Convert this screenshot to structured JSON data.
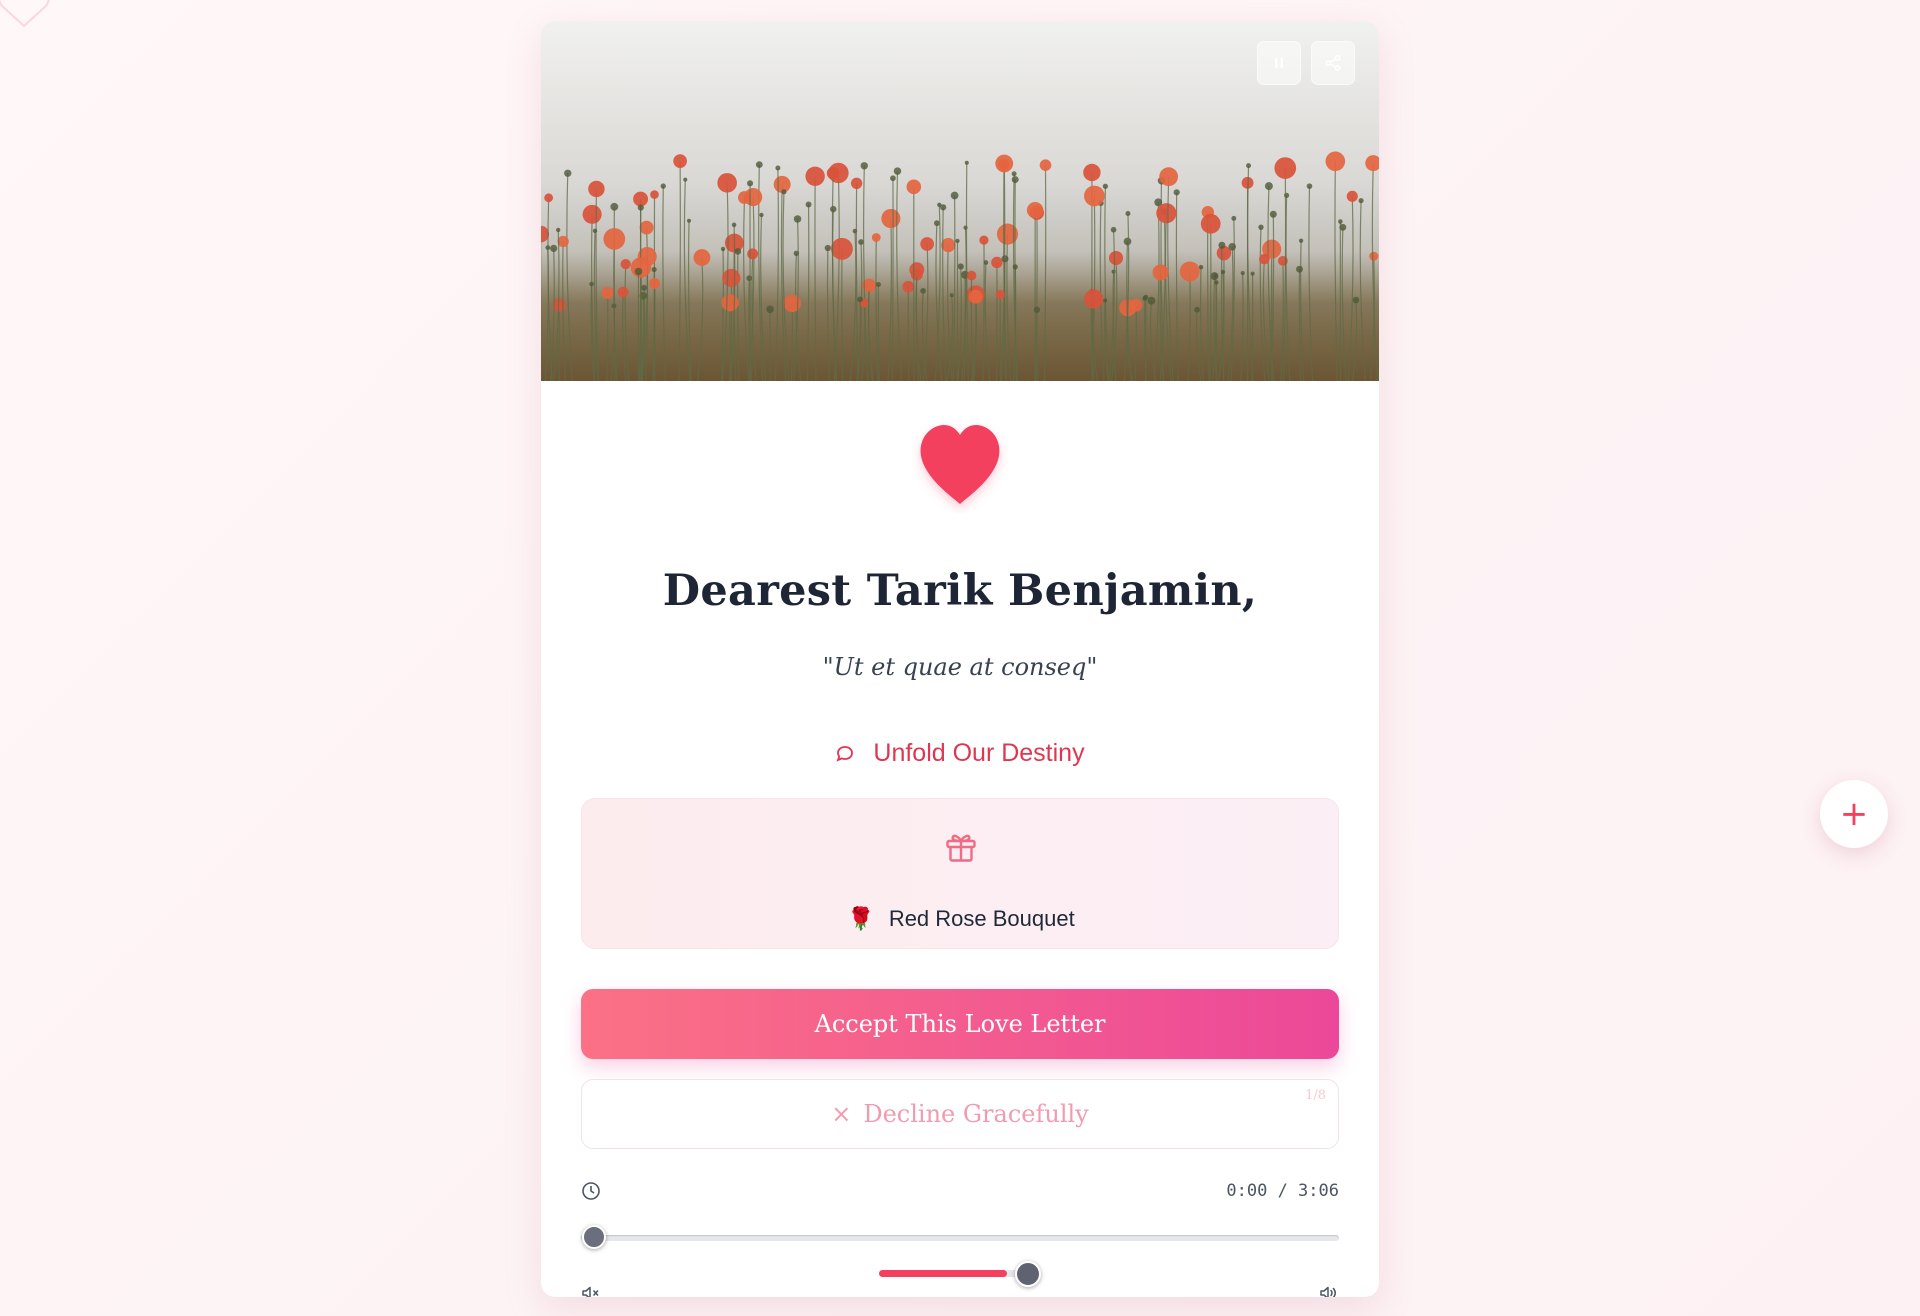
{
  "letter": {
    "greeting": "Dearest Tarik Benjamin,",
    "quote": "\"Ut et quae at conseq\"",
    "unfold_label": "Unfold Our Destiny"
  },
  "hero": {
    "image": "poppy-field-photo",
    "pause_icon": "pause-icon",
    "share_icon": "share-icon"
  },
  "gift": {
    "icon": "gift-icon",
    "emoji": "🌹",
    "label": "Red Rose Bouquet"
  },
  "actions": {
    "accept_label": "Accept This Love Letter",
    "decline_symbol": "×",
    "decline_label": "Decline Gracefully",
    "decline_counter": "1/8"
  },
  "player": {
    "time": "0:00 / 3:06",
    "progress": 0.0,
    "volume": 0.8
  },
  "fab": {
    "symbol": "+"
  },
  "colors": {
    "accent": "#f43f5e",
    "accept_gradient_start": "#fb7185",
    "accept_gradient_end": "#ec4899",
    "title": "#1e2535",
    "unfold_text": "#e0364f"
  }
}
